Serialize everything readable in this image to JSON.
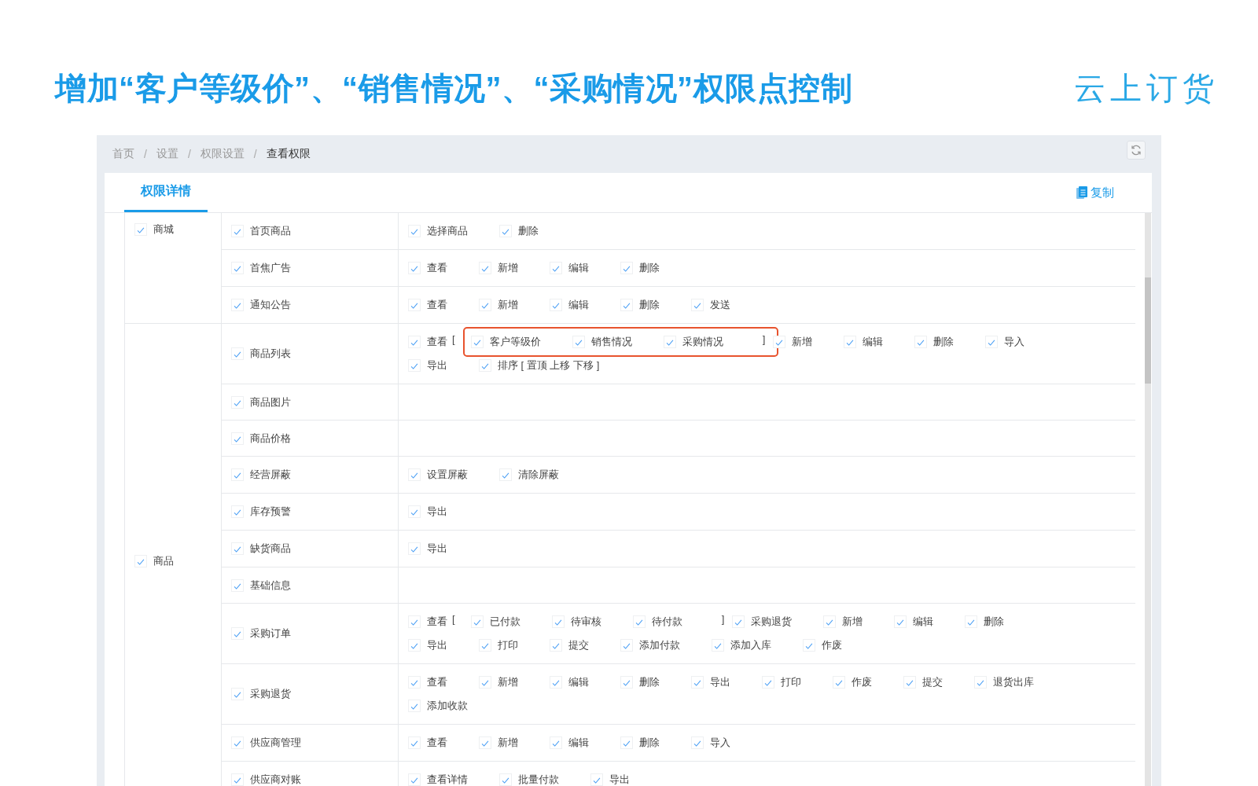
{
  "slide": {
    "title": "增加“客户等级价”、“销售情况”、“采购情况”权限点控制",
    "logo": "云上订货"
  },
  "breadcrumb": [
    {
      "kind": "link",
      "label": "首页"
    },
    {
      "kind": "separator",
      "label": "/"
    },
    {
      "kind": "link",
      "label": "设置"
    },
    {
      "kind": "separator",
      "label": "/"
    },
    {
      "kind": "link",
      "label": "权限设置"
    },
    {
      "kind": "separator",
      "label": "/"
    },
    {
      "kind": "current",
      "label": "查看权限"
    }
  ],
  "tabs": [
    {
      "label": "权限详情",
      "selected": true
    }
  ],
  "copy_button": "复制",
  "modules": [
    {
      "label": "商城",
      "checked": true,
      "rows": [
        {
          "label": "首页商品",
          "checked": true,
          "perms": [
            {
              "kind": "option",
              "label": "选择商品",
              "checked": true
            },
            {
              "kind": "option",
              "label": "删除",
              "checked": true
            }
          ]
        },
        {
          "label": "首焦广告",
          "checked": true,
          "perms": [
            {
              "kind": "option",
              "label": "查看",
              "checked": true
            },
            {
              "kind": "option",
              "label": "新增",
              "checked": true
            },
            {
              "kind": "option",
              "label": "编辑",
              "checked": true
            },
            {
              "kind": "option",
              "label": "删除",
              "checked": true
            }
          ]
        },
        {
          "label": "通知公告",
          "checked": true,
          "perms": [
            {
              "kind": "option",
              "label": "查看",
              "checked": true
            },
            {
              "kind": "option",
              "label": "新增",
              "checked": true
            },
            {
              "kind": "option",
              "label": "编辑",
              "checked": true
            },
            {
              "kind": "option",
              "label": "删除",
              "checked": true
            },
            {
              "kind": "option",
              "label": "发送",
              "checked": true
            }
          ]
        }
      ]
    },
    {
      "label": "商品",
      "checked": true,
      "rows": [
        {
          "label": "商品列表",
          "checked": true,
          "perms": [
            {
              "kind": "option",
              "label": "查看",
              "checked": true
            },
            {
              "kind": "bracket",
              "label": "["
            },
            {
              "kind": "group",
              "highlighted": true,
              "items": [
                {
                  "label": "客户等级价",
                  "checked": true
                },
                {
                  "label": "销售情况",
                  "checked": true
                },
                {
                  "label": "采购情况",
                  "checked": true
                }
              ]
            },
            {
              "kind": "bracket",
              "label": "]"
            },
            {
              "kind": "option",
              "label": "新增",
              "checked": true
            },
            {
              "kind": "option",
              "label": "编辑",
              "checked": true
            },
            {
              "kind": "option",
              "label": "删除",
              "checked": true
            },
            {
              "kind": "option",
              "label": "导入",
              "checked": true
            },
            {
              "kind": "option",
              "label": "导出",
              "checked": true
            },
            {
              "kind": "option",
              "label": "排序 [ 置顶 上移 下移 ]",
              "checked": true
            }
          ]
        },
        {
          "label": "商品图片",
          "checked": true,
          "perms": []
        },
        {
          "label": "商品价格",
          "checked": true,
          "perms": []
        },
        {
          "label": "经营屏蔽",
          "checked": true,
          "perms": [
            {
              "kind": "option",
              "label": "设置屏蔽",
              "checked": true
            },
            {
              "kind": "option",
              "label": "清除屏蔽",
              "checked": true
            }
          ]
        },
        {
          "label": "库存预警",
          "checked": true,
          "perms": [
            {
              "kind": "option",
              "label": "导出",
              "checked": true
            }
          ]
        },
        {
          "label": "缺货商品",
          "checked": true,
          "perms": [
            {
              "kind": "option",
              "label": "导出",
              "checked": true
            }
          ]
        },
        {
          "label": "基础信息",
          "checked": true,
          "perms": []
        },
        {
          "label": "采购订单",
          "checked": true,
          "perms": [
            {
              "kind": "option",
              "label": "查看",
              "checked": true
            },
            {
              "kind": "bracket",
              "label": "["
            },
            {
              "kind": "group",
              "highlighted": false,
              "items": [
                {
                  "label": "已付款",
                  "checked": true
                },
                {
                  "label": "待审核",
                  "checked": true
                },
                {
                  "label": "待付款",
                  "checked": true
                }
              ]
            },
            {
              "kind": "bracket",
              "label": "]"
            },
            {
              "kind": "option",
              "label": "采购退货",
              "checked": true
            },
            {
              "kind": "option",
              "label": "新增",
              "checked": true
            },
            {
              "kind": "option",
              "label": "编辑",
              "checked": true
            },
            {
              "kind": "option",
              "label": "删除",
              "checked": true
            },
            {
              "kind": "option",
              "label": "导出",
              "checked": true
            },
            {
              "kind": "option",
              "label": "打印",
              "checked": true
            },
            {
              "kind": "option",
              "label": "提交",
              "checked": true
            },
            {
              "kind": "option",
              "label": "添加付款",
              "checked": true
            },
            {
              "kind": "option",
              "label": "添加入库",
              "checked": true
            },
            {
              "kind": "option",
              "label": "作废",
              "checked": true
            }
          ]
        },
        {
          "label": "采购退货",
          "checked": true,
          "perms": [
            {
              "kind": "option",
              "label": "查看",
              "checked": true
            },
            {
              "kind": "option",
              "label": "新增",
              "checked": true
            },
            {
              "kind": "option",
              "label": "编辑",
              "checked": true
            },
            {
              "kind": "option",
              "label": "删除",
              "checked": true
            },
            {
              "kind": "option",
              "label": "导出",
              "checked": true
            },
            {
              "kind": "option",
              "label": "打印",
              "checked": true
            },
            {
              "kind": "option",
              "label": "作废",
              "checked": true
            },
            {
              "kind": "option",
              "label": "提交",
              "checked": true
            },
            {
              "kind": "option",
              "label": "退货出库",
              "checked": true
            },
            {
              "kind": "option",
              "label": "添加收款",
              "checked": true
            }
          ]
        },
        {
          "label": "供应商管理",
          "checked": true,
          "perms": [
            {
              "kind": "option",
              "label": "查看",
              "checked": true
            },
            {
              "kind": "option",
              "label": "新增",
              "checked": true
            },
            {
              "kind": "option",
              "label": "编辑",
              "checked": true
            },
            {
              "kind": "option",
              "label": "删除",
              "checked": true
            },
            {
              "kind": "option",
              "label": "导入",
              "checked": true
            }
          ]
        },
        {
          "label": "供应商对账",
          "checked": true,
          "perms": [
            {
              "kind": "option",
              "label": "查看详情",
              "checked": true
            },
            {
              "kind": "option",
              "label": "批量付款",
              "checked": true
            },
            {
              "kind": "option",
              "label": "导出",
              "checked": true
            }
          ]
        }
      ]
    }
  ]
}
